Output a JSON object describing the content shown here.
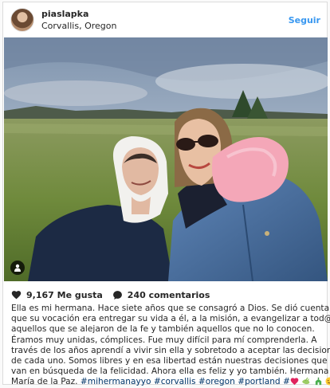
{
  "header": {
    "username": "piaslapka",
    "location": "Corvallis, Oregon",
    "follow_label": "Seguir"
  },
  "stats": {
    "likes": "9,167 Me gusta",
    "comments": "240 comentarios"
  },
  "caption": {
    "lines": [
      "Ella es mi hermana. Hace siete años que se consagró a Dios. Se dió cuenta,",
      "que su vocación era entregar su vida a él, a la misión, a evangelizar a tod@s",
      "aquellos que se alejaron de la fe y también aquellos que no lo conocen.",
      "Éramos muy unidas, cómplices. Fue muy difícil para mí comprenderla. A",
      "través de los años aprendí a vivir sin ella y sobretodo a aceptar las decisiones",
      "de cada uno. Somos libres y en esa libertad están nuestras decisiones que",
      "van en búsqueda de la felicidad. Ahora ella es feliz y yo también. Hermana"
    ],
    "last_prefix": "María de la Paz. ",
    "hashtags": [
      "#mihermanayyo",
      "#corvallis",
      "#oregon",
      "#portland",
      "#"
    ]
  },
  "icons": {
    "like": "heart-icon",
    "comment": "comment-bubble-icon",
    "tagged": "person-tag-icon"
  },
  "colors": {
    "link": "#3897f0",
    "hashtag": "#003569",
    "text": "#262626"
  }
}
